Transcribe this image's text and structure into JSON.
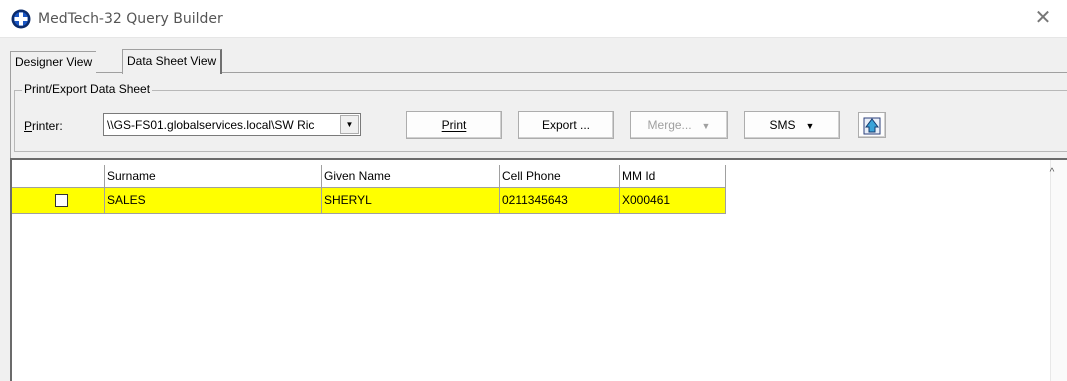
{
  "window": {
    "title": "MedTech-32 Query Builder"
  },
  "tabs": [
    {
      "label": "Designer View",
      "active": false
    },
    {
      "label": "Data Sheet View",
      "active": true
    }
  ],
  "group": {
    "title": "Print/Export Data Sheet"
  },
  "printer": {
    "label": "Printer:",
    "value": "\\\\GS-FS01.globalservices.local\\SW Ric"
  },
  "buttons": {
    "print": "Print",
    "export": "Export ...",
    "merge": "Merge...",
    "sms": "SMS"
  },
  "grid": {
    "headers": [
      "Surname",
      "Given Name",
      "Cell Phone",
      "MM Id"
    ],
    "rows": [
      {
        "checked": false,
        "cells": [
          "SALES",
          "SHERYL",
          "0211345643",
          "X000461"
        ]
      }
    ],
    "highlight_color": "#ffff00"
  },
  "icons": {
    "app": "medtech-app-icon",
    "close": "close-icon",
    "toolbar_extra": "tree-upload-icon",
    "scroll_up": "scroll-up-arrow-icon"
  }
}
